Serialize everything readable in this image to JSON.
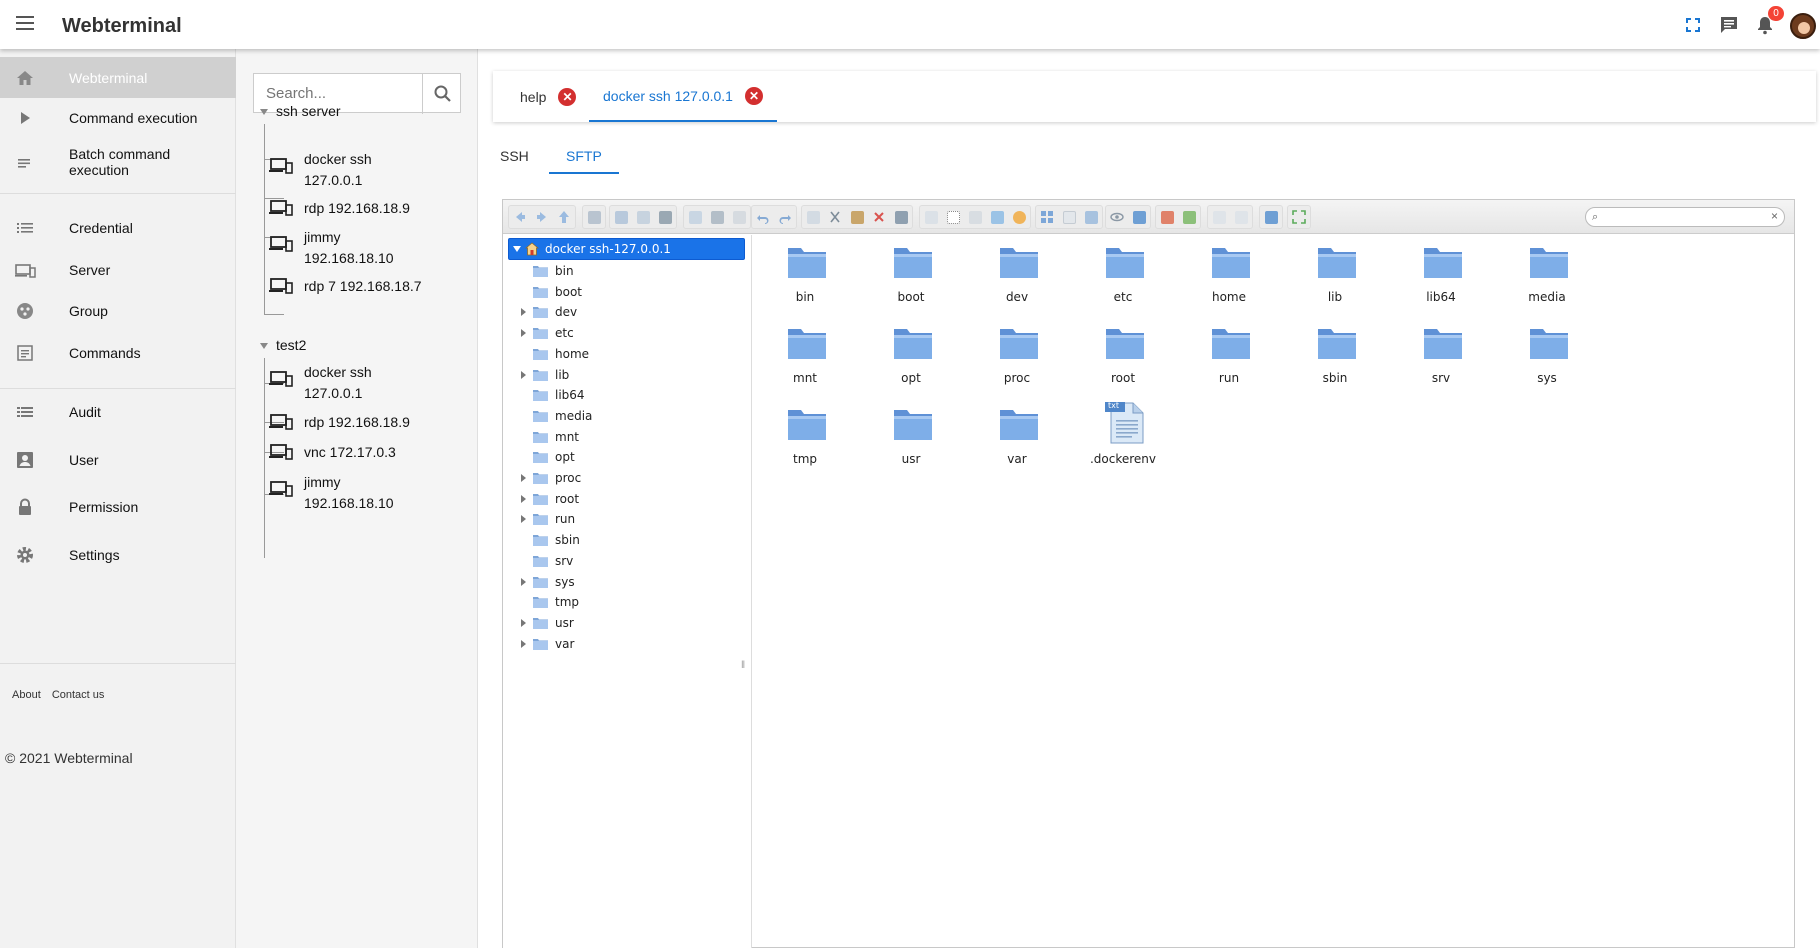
{
  "app": {
    "title": "Webterminal",
    "notification_count": "0"
  },
  "nav": {
    "items": [
      {
        "label": "Webterminal",
        "icon": "home-icon",
        "active": true
      },
      {
        "label": "Command execution",
        "icon": "play-icon"
      },
      {
        "label": "Batch command execution",
        "icon": "batch-list-icon"
      },
      {
        "label": "Credential",
        "icon": "list-icon"
      },
      {
        "label": "Server",
        "icon": "devices-icon"
      },
      {
        "label": "Group",
        "icon": "group-icon"
      },
      {
        "label": "Commands",
        "icon": "commands-icon"
      },
      {
        "label": "Audit",
        "icon": "audit-icon"
      },
      {
        "label": "User",
        "icon": "user-icon"
      },
      {
        "label": "Permission",
        "icon": "lock-icon"
      },
      {
        "label": "Settings",
        "icon": "gear-icon"
      }
    ],
    "footer": {
      "about": "About",
      "contact": "Contact us",
      "copyright": "© 2021 Webterminal"
    }
  },
  "servers": {
    "search_placeholder": "Search...",
    "groups": [
      {
        "name": "ssh server",
        "items": [
          "docker ssh 127.0.0.1",
          "rdp 192.168.18.9",
          "jimmy 192.168.18.10",
          "rdp 7 192.168.18.7"
        ]
      },
      {
        "name": "test2",
        "items": [
          "docker ssh 127.0.0.1",
          "rdp 192.168.18.9",
          "vnc 172.17.0.3",
          "jimmy 192.168.18.10"
        ]
      }
    ]
  },
  "tabs": [
    {
      "label": "help"
    },
    {
      "label": "docker ssh 127.0.0.1",
      "active": true
    }
  ],
  "subtabs": [
    {
      "label": "SSH"
    },
    {
      "label": "SFTP",
      "active": true
    }
  ],
  "sftp": {
    "root": "docker ssh-127.0.0.1",
    "tree": [
      {
        "name": "bin",
        "expandable": false
      },
      {
        "name": "boot",
        "expandable": false
      },
      {
        "name": "dev",
        "expandable": true
      },
      {
        "name": "etc",
        "expandable": true
      },
      {
        "name": "home",
        "expandable": false
      },
      {
        "name": "lib",
        "expandable": true
      },
      {
        "name": "lib64",
        "expandable": false
      },
      {
        "name": "media",
        "expandable": false
      },
      {
        "name": "mnt",
        "expandable": false
      },
      {
        "name": "opt",
        "expandable": false
      },
      {
        "name": "proc",
        "expandable": true
      },
      {
        "name": "root",
        "expandable": true
      },
      {
        "name": "run",
        "expandable": true
      },
      {
        "name": "sbin",
        "expandable": false
      },
      {
        "name": "srv",
        "expandable": false
      },
      {
        "name": "sys",
        "expandable": true
      },
      {
        "name": "tmp",
        "expandable": false
      },
      {
        "name": "usr",
        "expandable": true
      },
      {
        "name": "var",
        "expandable": true
      }
    ],
    "files": [
      {
        "name": "bin",
        "type": "folder"
      },
      {
        "name": "boot",
        "type": "folder"
      },
      {
        "name": "dev",
        "type": "folder"
      },
      {
        "name": "etc",
        "type": "folder"
      },
      {
        "name": "home",
        "type": "folder"
      },
      {
        "name": "lib",
        "type": "folder"
      },
      {
        "name": "lib64",
        "type": "folder"
      },
      {
        "name": "media",
        "type": "folder"
      },
      {
        "name": "mnt",
        "type": "folder"
      },
      {
        "name": "opt",
        "type": "folder"
      },
      {
        "name": "proc",
        "type": "folder"
      },
      {
        "name": "root",
        "type": "folder"
      },
      {
        "name": "run",
        "type": "folder"
      },
      {
        "name": "sbin",
        "type": "folder"
      },
      {
        "name": "srv",
        "type": "folder"
      },
      {
        "name": "sys",
        "type": "folder"
      },
      {
        "name": "tmp",
        "type": "folder"
      },
      {
        "name": "usr",
        "type": "folder"
      },
      {
        "name": "var",
        "type": "folder"
      },
      {
        "name": ".dockerenv",
        "type": "txt"
      }
    ],
    "file_badge": "txt",
    "search_value": ""
  },
  "colors": {
    "accent": "#1976d2",
    "danger": "#d32f2f",
    "folder": "#6fa3e6",
    "selection": "#1a73e8"
  }
}
